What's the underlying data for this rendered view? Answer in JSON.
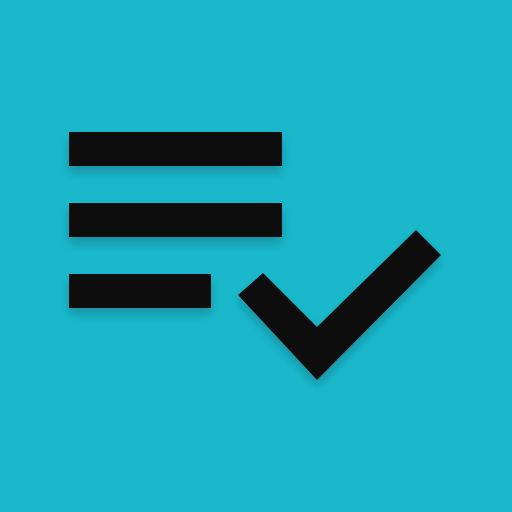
{
  "app_icon": {
    "name": "playlist-add-check-icon",
    "background_color": "#1bb8cc",
    "glyph_color": "#0b0b0b",
    "shadow_color": "#0a6f7c",
    "list_lines": 3,
    "has_checkmark": true
  }
}
